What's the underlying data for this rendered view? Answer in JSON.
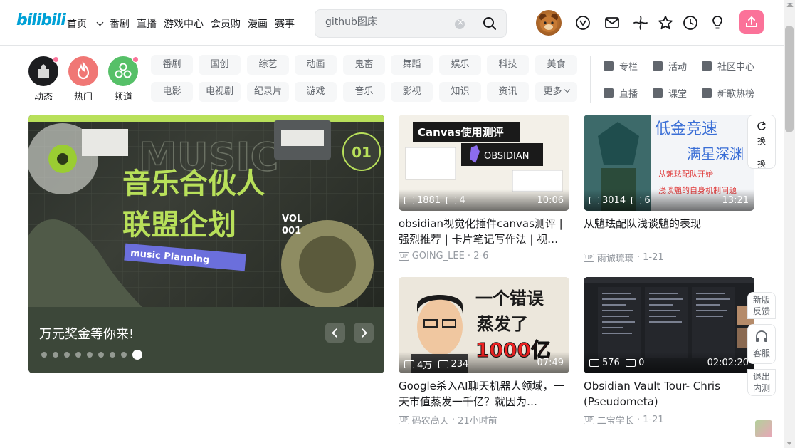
{
  "header": {
    "logo": "bilibili",
    "nav": [
      "首页",
      "番剧",
      "直播",
      "游戏中心",
      "会员购",
      "漫画",
      "赛事"
    ],
    "search_placeholder": "github图床"
  },
  "header_icons": [
    "user-avatar",
    "vip-icon",
    "message-icon",
    "dynamic-icon",
    "favorite-icon",
    "history-icon",
    "creator-icon",
    "upload-icon"
  ],
  "channels": {
    "circles": [
      {
        "label": "动态",
        "color": "#18191c"
      },
      {
        "label": "热门",
        "color": "#f07775"
      },
      {
        "label": "频道",
        "color": "#56c068"
      }
    ],
    "row1": [
      "番剧",
      "国创",
      "综艺",
      "动画",
      "鬼畜",
      "舞蹈",
      "娱乐",
      "科技",
      "美食"
    ],
    "row2": [
      "电影",
      "电视剧",
      "纪录片",
      "游戏",
      "音乐",
      "影视",
      "知识",
      "资讯",
      "更多"
    ],
    "right": [
      {
        "label": "专栏",
        "icon": "article-icon"
      },
      {
        "label": "活动",
        "icon": "flag-icon"
      },
      {
        "label": "社区中心",
        "icon": "community-icon"
      },
      {
        "label": "直播",
        "icon": "live-icon"
      },
      {
        "label": "课堂",
        "icon": "class-icon"
      },
      {
        "label": "新歌热榜",
        "icon": "music-icon"
      }
    ]
  },
  "banner": {
    "title": "万元奖金等你来!",
    "poster": {
      "line1": "音乐合伙人",
      "line2": "联盟企划",
      "sub": "music Planning",
      "vol": "VOL",
      "num": "001",
      "badge": "01",
      "bg_word": "MUSIC"
    },
    "dot_count": 9,
    "active_dot": 8
  },
  "cards": [
    {
      "views": "1881",
      "danmaku": "4",
      "duration": "10:06",
      "title": "obsidian视觉化插件canvas测评 | 强烈推荐 | 卡片笔记写作法 | 视…",
      "author": "GOING_LEE",
      "date": "2-6",
      "thumb_text": [
        "Canvas使用测评",
        "OBSIDIAN"
      ]
    },
    {
      "views": "3014",
      "danmaku": "6",
      "duration": "13:21",
      "title": "从魈珐配队浅谈魈的表现",
      "author": "雨诚琉璃",
      "date": "1-21",
      "thumb_text": [
        "低金竞速",
        "满星深渊",
        "从魈珐配队开始",
        "浅谈魈的自身机制问题"
      ]
    },
    {
      "views": "4万",
      "danmaku": "234",
      "duration": "07:49",
      "title": "Google杀入AI聊天机器人领域，一天市值蒸发一千亿？就因为…",
      "author": "码农高天",
      "date": "21小时前",
      "thumb_text": [
        "一个错误",
        "蒸发了",
        "1000亿"
      ]
    },
    {
      "views": "576",
      "danmaku": "0",
      "duration": "02:02:20",
      "title": "Obsidian Vault Tour- Chris (Pseudometa)",
      "author": "二宝学长",
      "date": "1-21",
      "thumb_text": []
    }
  ],
  "side_buttons": {
    "refresh": "换一换",
    "feedback": "新版反馈",
    "service": "客服",
    "exit": "退出内测"
  },
  "colors": {
    "brand": "#00a1d6",
    "pink": "#fb7299"
  }
}
